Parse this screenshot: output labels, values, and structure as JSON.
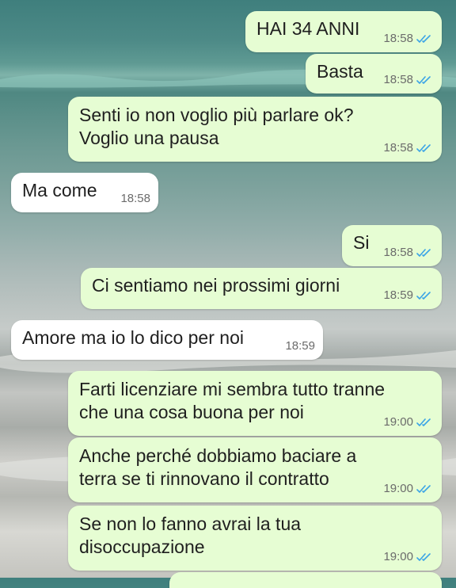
{
  "colors": {
    "outgoing_bubble": "#e6fdd3",
    "incoming_bubble": "#ffffff",
    "read_ticks": "#3ba4e6"
  },
  "messages": [
    {
      "direction": "out",
      "lines": [
        "HAI 34 ANNI"
      ],
      "time": "18:58",
      "status": "read"
    },
    {
      "direction": "out",
      "lines": [
        "Basta"
      ],
      "time": "18:58",
      "status": "read"
    },
    {
      "direction": "out",
      "lines": [
        "Senti io non voglio più parlare ok?",
        "Voglio una pausa"
      ],
      "time": "18:58",
      "status": "read"
    },
    {
      "direction": "in",
      "lines": [
        "Ma come"
      ],
      "time": "18:58"
    },
    {
      "direction": "out",
      "lines": [
        "Si"
      ],
      "time": "18:58",
      "status": "read"
    },
    {
      "direction": "out",
      "lines": [
        "Ci sentiamo nei prossimi giorni"
      ],
      "time": "18:59",
      "status": "read"
    },
    {
      "direction": "in",
      "lines": [
        "Amore ma io lo dico per noi"
      ],
      "time": "18:59"
    },
    {
      "direction": "out",
      "lines": [
        "Farti licenziare mi sembra tutto tranne",
        "che una cosa buona per noi"
      ],
      "time": "19:00",
      "status": "read"
    },
    {
      "direction": "out",
      "lines": [
        "Anche perché dobbiamo baciare a",
        "terra se ti rinnovano il contratto"
      ],
      "time": "19:00",
      "status": "read"
    },
    {
      "direction": "out",
      "lines": [
        "Se non lo fanno avrai la tua",
        "disoccupazione"
      ],
      "time": "19:00",
      "status": "read"
    }
  ]
}
